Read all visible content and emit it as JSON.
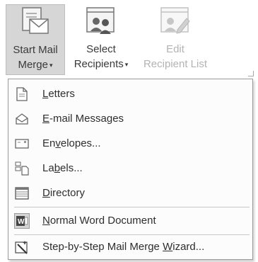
{
  "ribbon": {
    "start_mail_merge": {
      "line1": "Start Mail",
      "line2": "Merge",
      "caret": "▾",
      "icon": "start-mail-merge-icon"
    },
    "select_recipients": {
      "line1": "Select",
      "line2": "Recipients",
      "caret": "▾",
      "icon": "select-recipients-icon"
    },
    "edit_recipient_list": {
      "line1": "Edit",
      "line2": "Recipient List",
      "icon": "edit-recipient-list-icon"
    }
  },
  "menu": {
    "items": [
      {
        "key": "L",
        "rest": "etters",
        "icon": "document-icon"
      },
      {
        "key": "E",
        "rest": "-mail Messages",
        "icon": "envelope-open-icon"
      },
      {
        "pre": "En",
        "key": "v",
        "rest": "elopes...",
        "icon": "envelope-icon"
      },
      {
        "pre": "La",
        "key": "b",
        "rest": "els...",
        "icon": "labels-icon"
      },
      {
        "key": "D",
        "rest": "irectory",
        "icon": "directory-icon"
      },
      {
        "key": "N",
        "rest": "ormal Word Document",
        "icon": "word-document-icon"
      },
      {
        "pre": "Step-by-Step Mail Merge ",
        "key": "W",
        "rest": "izard...",
        "icon": "wizard-icon"
      }
    ]
  }
}
